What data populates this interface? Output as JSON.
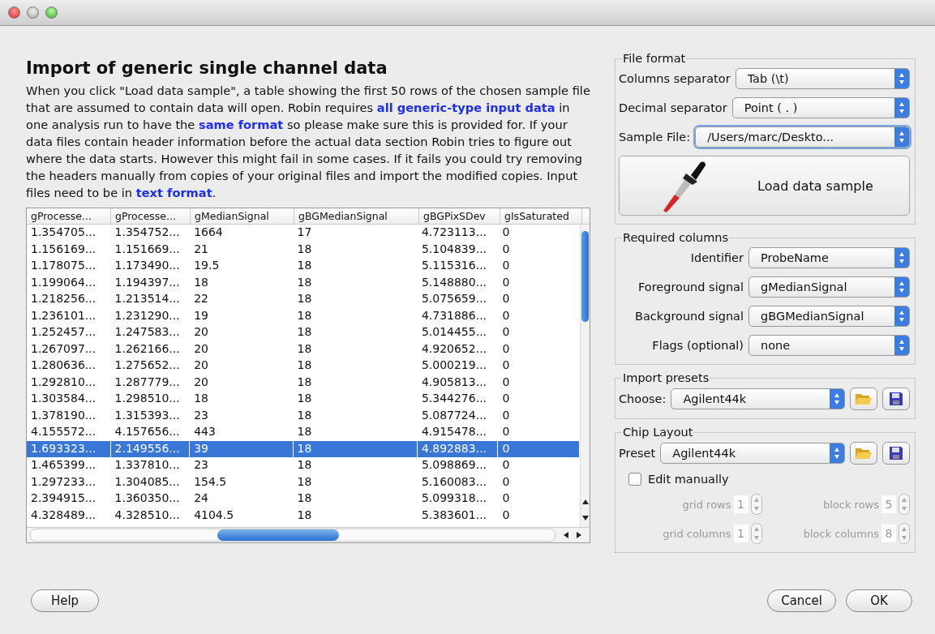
{
  "heading": "Import of generic single channel data",
  "description": [
    {
      "kind": "text",
      "text": "When you click \"Load data sample\", a table showing the first 50 rows of the chosen sample file that are assumed to contain data will open. Robin requires "
    },
    {
      "kind": "link",
      "text": "all generic-type input data"
    },
    {
      "kind": "text",
      "text": " in one analysis run to have the "
    },
    {
      "kind": "link",
      "text": "same format"
    },
    {
      "kind": "text",
      "text": " so please make sure this is provided for. If your data files contain header information before the actual data section Robin tries to figure out where the data starts. However this might fail in some cases. If it fails you could try removing the headers manually from copies of your original files and import the modified copies. Input files need to be in "
    },
    {
      "kind": "link",
      "text": "text format"
    },
    {
      "kind": "text",
      "text": "."
    }
  ],
  "table": {
    "columns": [
      "gProcesse...",
      "gProcesse...",
      "gMedianSignal",
      "gBGMedianSignal",
      "gBGPixSDev",
      "gIsSaturated"
    ],
    "rows": [
      {
        "cells": [
          "1.354705...",
          "1.354752...",
          "1664",
          "17",
          "4.723113...",
          "0"
        ],
        "selected": false
      },
      {
        "cells": [
          "1.156169...",
          "1.151669...",
          "21",
          "18",
          "5.104839...",
          "0"
        ],
        "selected": false
      },
      {
        "cells": [
          "1.178075...",
          "1.173490...",
          "19.5",
          "18",
          "5.115316...",
          "0"
        ],
        "selected": false
      },
      {
        "cells": [
          "1.199064...",
          "1.194397...",
          "18",
          "18",
          "5.148880...",
          "0"
        ],
        "selected": false
      },
      {
        "cells": [
          "1.218256...",
          "1.213514...",
          "22",
          "18",
          "5.075659...",
          "0"
        ],
        "selected": false
      },
      {
        "cells": [
          "1.236101...",
          "1.231290...",
          "19",
          "18",
          "4.731886...",
          "0"
        ],
        "selected": false
      },
      {
        "cells": [
          "1.252457...",
          "1.247583...",
          "20",
          "18",
          "5.014455...",
          "0"
        ],
        "selected": false
      },
      {
        "cells": [
          "1.267097...",
          "1.262166...",
          "20",
          "18",
          "4.920652...",
          "0"
        ],
        "selected": false
      },
      {
        "cells": [
          "1.280636...",
          "1.275652...",
          "20",
          "18",
          "5.000219...",
          "0"
        ],
        "selected": false
      },
      {
        "cells": [
          "1.292810...",
          "1.287779...",
          "20",
          "18",
          "4.905813...",
          "0"
        ],
        "selected": false
      },
      {
        "cells": [
          "1.303584...",
          "1.298510...",
          "18",
          "18",
          "5.344276...",
          "0"
        ],
        "selected": false
      },
      {
        "cells": [
          "1.378190...",
          "1.315393...",
          "23",
          "18",
          "5.087724...",
          "0"
        ],
        "selected": false
      },
      {
        "cells": [
          "4.155572...",
          "4.157656...",
          "443",
          "18",
          "4.915478...",
          "0"
        ],
        "selected": false
      },
      {
        "cells": [
          "1.693323...",
          "2.149556...",
          "39",
          "18",
          "4.892883...",
          "0"
        ],
        "selected": true
      },
      {
        "cells": [
          "1.465399...",
          "1.337810...",
          "23",
          "18",
          "5.098869...",
          "0"
        ],
        "selected": false
      },
      {
        "cells": [
          "1.297233...",
          "1.304085...",
          "154.5",
          "18",
          "5.160083...",
          "0"
        ],
        "selected": false
      },
      {
        "cells": [
          "2.394915...",
          "1.360350...",
          "24",
          "18",
          "5.099318...",
          "0"
        ],
        "selected": false
      },
      {
        "cells": [
          "4.328489...",
          "4.328510...",
          "4104.5",
          "18",
          "5.383601...",
          "0"
        ],
        "selected": false
      }
    ]
  },
  "file_format": {
    "title": "File format",
    "fields": [
      {
        "label": "Columns separator",
        "value": "Tab (\\t)",
        "focused": false
      },
      {
        "label": "Decimal separator",
        "value": "Point ( . )",
        "focused": false
      },
      {
        "label": "Sample File:",
        "value": "/Users/marc/Deskto...",
        "focused": true
      }
    ],
    "load_button": "Load data sample"
  },
  "required_columns": {
    "title": "Required columns",
    "fields": [
      {
        "label": "Identifier",
        "value": "ProbeName"
      },
      {
        "label": "Foreground signal",
        "value": "gMedianSignal"
      },
      {
        "label": "Background signal",
        "value": "gBGMedianSignal"
      },
      {
        "label": "Flags (optional)",
        "value": "none"
      }
    ]
  },
  "import_presets": {
    "title": "Import presets",
    "label": "Choose:",
    "value": "Agilent44k"
  },
  "chip_layout": {
    "title": "Chip Layout",
    "label": "Preset",
    "value": "Agilent44k",
    "edit_manually": {
      "label": "Edit manually",
      "checked": false
    },
    "spinners": [
      {
        "label": "grid rows",
        "value": "1",
        "disabled": true
      },
      {
        "label": "block rows",
        "value": "5",
        "disabled": true
      },
      {
        "label": "grid columns",
        "value": "1",
        "disabled": true
      },
      {
        "label": "block columns",
        "value": "8",
        "disabled": true
      }
    ]
  },
  "footer": {
    "help": "Help",
    "cancel": "Cancel",
    "ok": "OK"
  }
}
